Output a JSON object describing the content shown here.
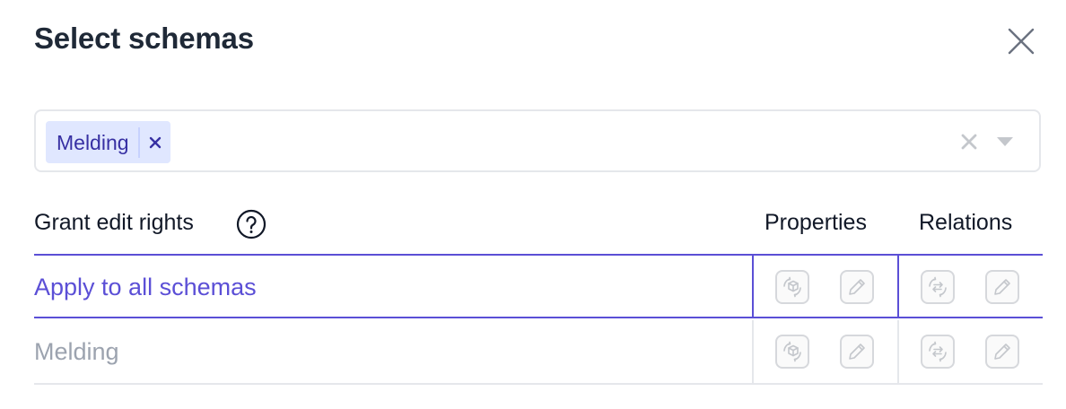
{
  "dialog": {
    "title": "Select schemas",
    "close_icon": "close-icon"
  },
  "select": {
    "chips": [
      {
        "label": "Melding"
      }
    ],
    "clear_icon": "clear-icon",
    "dropdown_icon": "chevron-down-icon"
  },
  "permissions": {
    "grant_label": "Grant edit rights",
    "help_icon": "help-icon",
    "columns": {
      "properties": "Properties",
      "relations": "Relations"
    },
    "rows": [
      {
        "label": "Apply to all schemas"
      },
      {
        "label": "Melding"
      }
    ]
  },
  "colors": {
    "accent": "#5b4fd6",
    "chip_bg": "#e0e7ff",
    "chip_text": "#3730a3",
    "muted": "#9ca3af"
  }
}
